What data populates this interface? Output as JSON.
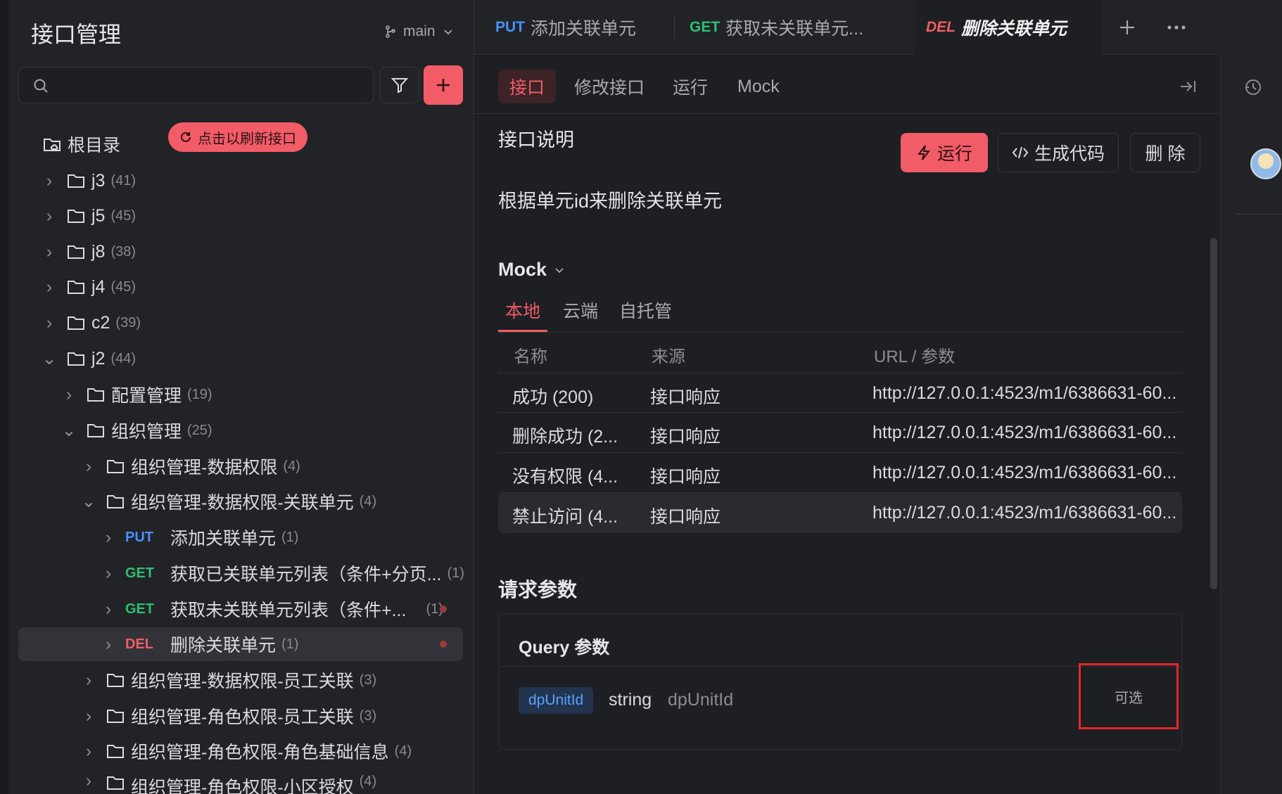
{
  "sidebar": {
    "title": "接口管理",
    "branch": "main",
    "search_placeholder": "",
    "refresh_label": "点击以刷新接口",
    "root_label": "根目录",
    "folders": [
      {
        "name": "j3",
        "count": "(41)"
      },
      {
        "name": "j5",
        "count": "(45)"
      },
      {
        "name": "j8",
        "count": "(38)"
      },
      {
        "name": "j4",
        "count": "(45)"
      },
      {
        "name": "c2",
        "count": "(39)"
      },
      {
        "name": "j2",
        "count": "(44)"
      }
    ],
    "sub_folders": [
      {
        "name": "配置管理",
        "count": "(19)"
      },
      {
        "name": "组织管理",
        "count": "(25)"
      },
      {
        "name": "组织管理-数据权限",
        "count": "(4)"
      },
      {
        "name": "组织管理-数据权限-关联单元",
        "count": "(4)"
      }
    ],
    "endpoints": [
      {
        "method": "PUT",
        "name": "添加关联单元",
        "count": "(1)"
      },
      {
        "method": "GET",
        "name": "获取已关联单元列表（条件+分页...",
        "count": "(1)"
      },
      {
        "method": "GET",
        "name": "获取未关联单元列表（条件+...",
        "count": "(1)"
      },
      {
        "method": "DEL",
        "name": "删除关联单元",
        "count": "(1)"
      }
    ],
    "more_folders": [
      {
        "name": "组织管理-数据权限-员工关联",
        "count": "(3)"
      },
      {
        "name": "组织管理-角色权限-员工关联",
        "count": "(3)"
      },
      {
        "name": "组织管理-角色权限-角色基础信息",
        "count": "(4)"
      },
      {
        "name": "组织管理-角色权限-小区授权",
        "count": "(4)"
      }
    ]
  },
  "tabs": [
    {
      "method": "PUT",
      "label": "添加关联单元"
    },
    {
      "method": "GET",
      "label": "获取未关联单元..."
    },
    {
      "method": "DEL",
      "label": "删除关联单元"
    }
  ],
  "subtabs": [
    "接口",
    "修改接口",
    "运行",
    "Mock"
  ],
  "main": {
    "section_title": "接口说明",
    "description": "根据单元id来删除关联单元",
    "run_label": "运行",
    "gen_code_label": "生成代码",
    "delete_label": "删 除"
  },
  "mock": {
    "title": "Mock",
    "tabs": [
      "本地",
      "云端",
      "自托管"
    ],
    "columns": [
      "名称",
      "来源",
      "URL / 参数"
    ],
    "rows": [
      {
        "name": "成功 (200)",
        "source": "接口响应",
        "url": "http://127.0.0.1:4523/m1/6386631-60..."
      },
      {
        "name": "删除成功 (2...",
        "source": "接口响应",
        "url": "http://127.0.0.1:4523/m1/6386631-60..."
      },
      {
        "name": "没有权限 (4...",
        "source": "接口响应",
        "url": "http://127.0.0.1:4523/m1/6386631-60..."
      },
      {
        "name": "禁止访问 (4...",
        "source": "接口响应",
        "url": "http://127.0.0.1:4523/m1/6386631-60..."
      }
    ]
  },
  "request": {
    "title": "请求参数",
    "query_title": "Query 参数",
    "param": {
      "name": "dpUnitId",
      "type": "string",
      "desc": "dpUnitId",
      "optional": "可选"
    }
  },
  "colors": {
    "accent": "#f25c67",
    "put": "#4a90ff",
    "get": "#2fbf71",
    "del": "#f25c67"
  }
}
